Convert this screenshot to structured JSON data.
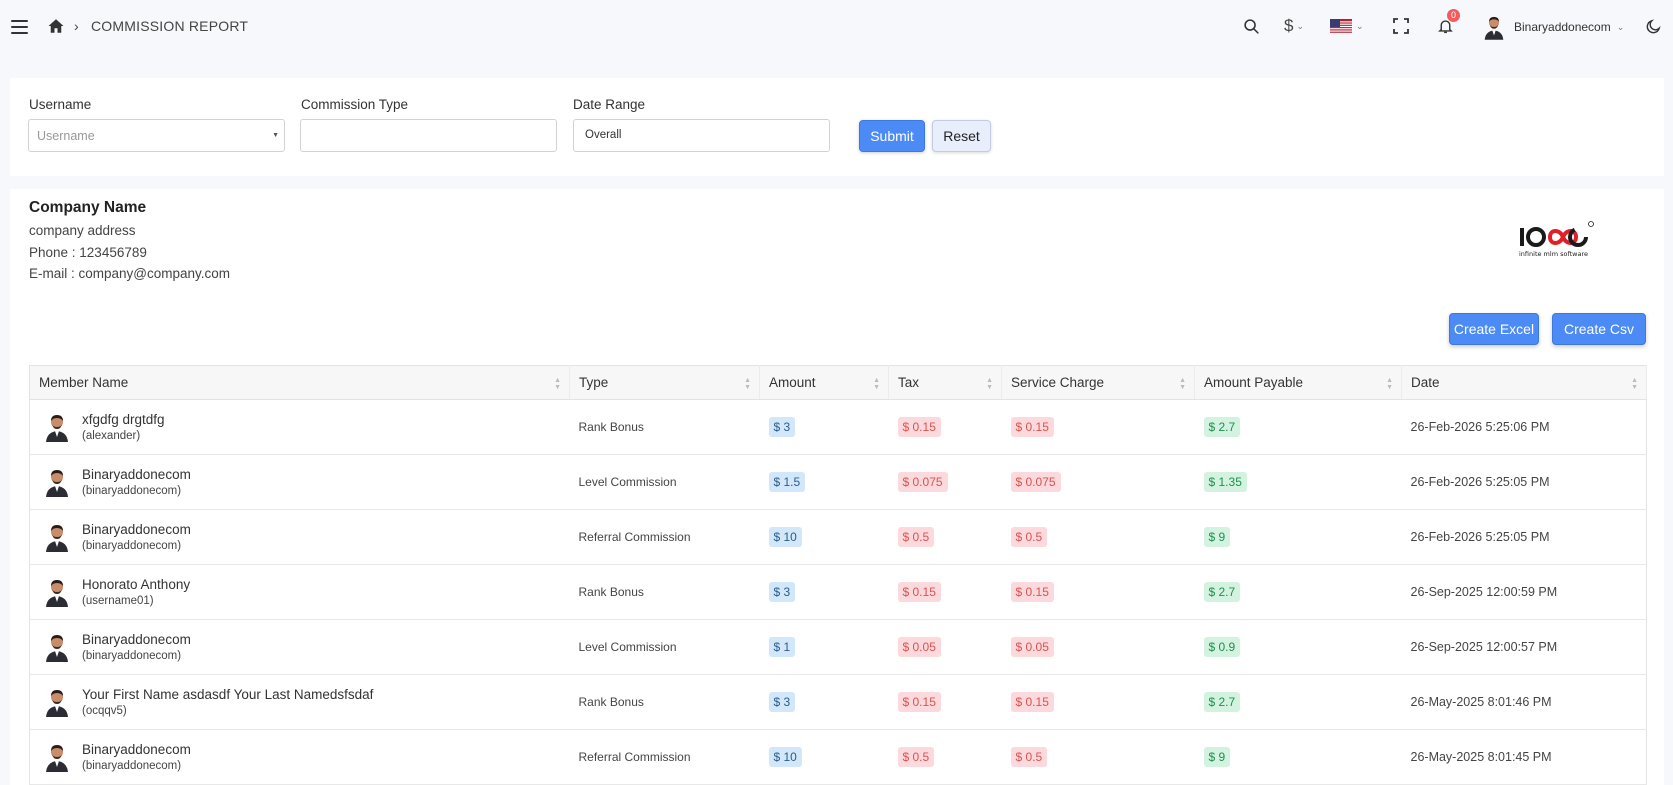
{
  "header": {
    "page_title": "COMMISSION REPORT",
    "breadcrumb_sep": "›",
    "currency_symbol": "$",
    "notification_count": "0",
    "user_name": "Binaryaddonecom"
  },
  "filters": {
    "username_label": "Username",
    "username_placeholder": "Username",
    "commission_type_label": "Commission Type",
    "commission_type_value": "",
    "date_range_label": "Date Range",
    "date_range_value": "Overall",
    "submit_label": "Submit",
    "reset_label": "Reset"
  },
  "company": {
    "name": "Company Name",
    "address": "company address",
    "phone": "Phone : 123456789",
    "email": "E-mail : company@company.com",
    "logo_tagline": "infinite mlm software"
  },
  "export": {
    "excel_label": "Create Excel",
    "csv_label": "Create Csv"
  },
  "table": {
    "columns": [
      "Member Name",
      "Type",
      "Amount",
      "Tax",
      "Service Charge",
      "Amount Payable",
      "Date"
    ],
    "rows": [
      {
        "name": "xfgdfg drgtdfg",
        "username": "(alexander)",
        "type": "Rank Bonus",
        "amount": "$ 3",
        "tax": "$ 0.15",
        "service": "$ 0.15",
        "payable": "$ 2.7",
        "date": "26-Feb-2026 5:25:06 PM"
      },
      {
        "name": "Binaryaddonecom",
        "username": "(binaryaddonecom)",
        "type": "Level Commission",
        "amount": "$ 1.5",
        "tax": "$ 0.075",
        "service": "$ 0.075",
        "payable": "$ 1.35",
        "date": "26-Feb-2026 5:25:05 PM"
      },
      {
        "name": "Binaryaddonecom",
        "username": "(binaryaddonecom)",
        "type": "Referral Commission",
        "amount": "$ 10",
        "tax": "$ 0.5",
        "service": "$ 0.5",
        "payable": "$ 9",
        "date": "26-Feb-2026 5:25:05 PM"
      },
      {
        "name": "Honorato Anthony",
        "username": "(username01)",
        "type": "Rank Bonus",
        "amount": "$ 3",
        "tax": "$ 0.15",
        "service": "$ 0.15",
        "payable": "$ 2.7",
        "date": "26-Sep-2025 12:00:59 PM"
      },
      {
        "name": "Binaryaddonecom",
        "username": "(binaryaddonecom)",
        "type": "Level Commission",
        "amount": "$ 1",
        "tax": "$ 0.05",
        "service": "$ 0.05",
        "payable": "$ 0.9",
        "date": "26-Sep-2025 12:00:57 PM"
      },
      {
        "name": "Your First Name asdasdf Your Last Namedsfsdaf",
        "username": "(ocqqv5)",
        "type": "Rank Bonus",
        "amount": "$ 3",
        "tax": "$ 0.15",
        "service": "$ 0.15",
        "payable": "$ 2.7",
        "date": "26-May-2025 8:01:46 PM"
      },
      {
        "name": "Binaryaddonecom",
        "username": "(binaryaddonecom)",
        "type": "Referral Commission",
        "amount": "$ 10",
        "tax": "$ 0.5",
        "service": "$ 0.5",
        "payable": "$ 9",
        "date": "26-May-2025 8:01:45 PM"
      }
    ]
  },
  "colors": {
    "accent": "#4c8bf5",
    "amount_pill": "#d2e8fa",
    "deduction_pill": "#fcd9dd",
    "payable_pill": "#d3f3e0"
  }
}
